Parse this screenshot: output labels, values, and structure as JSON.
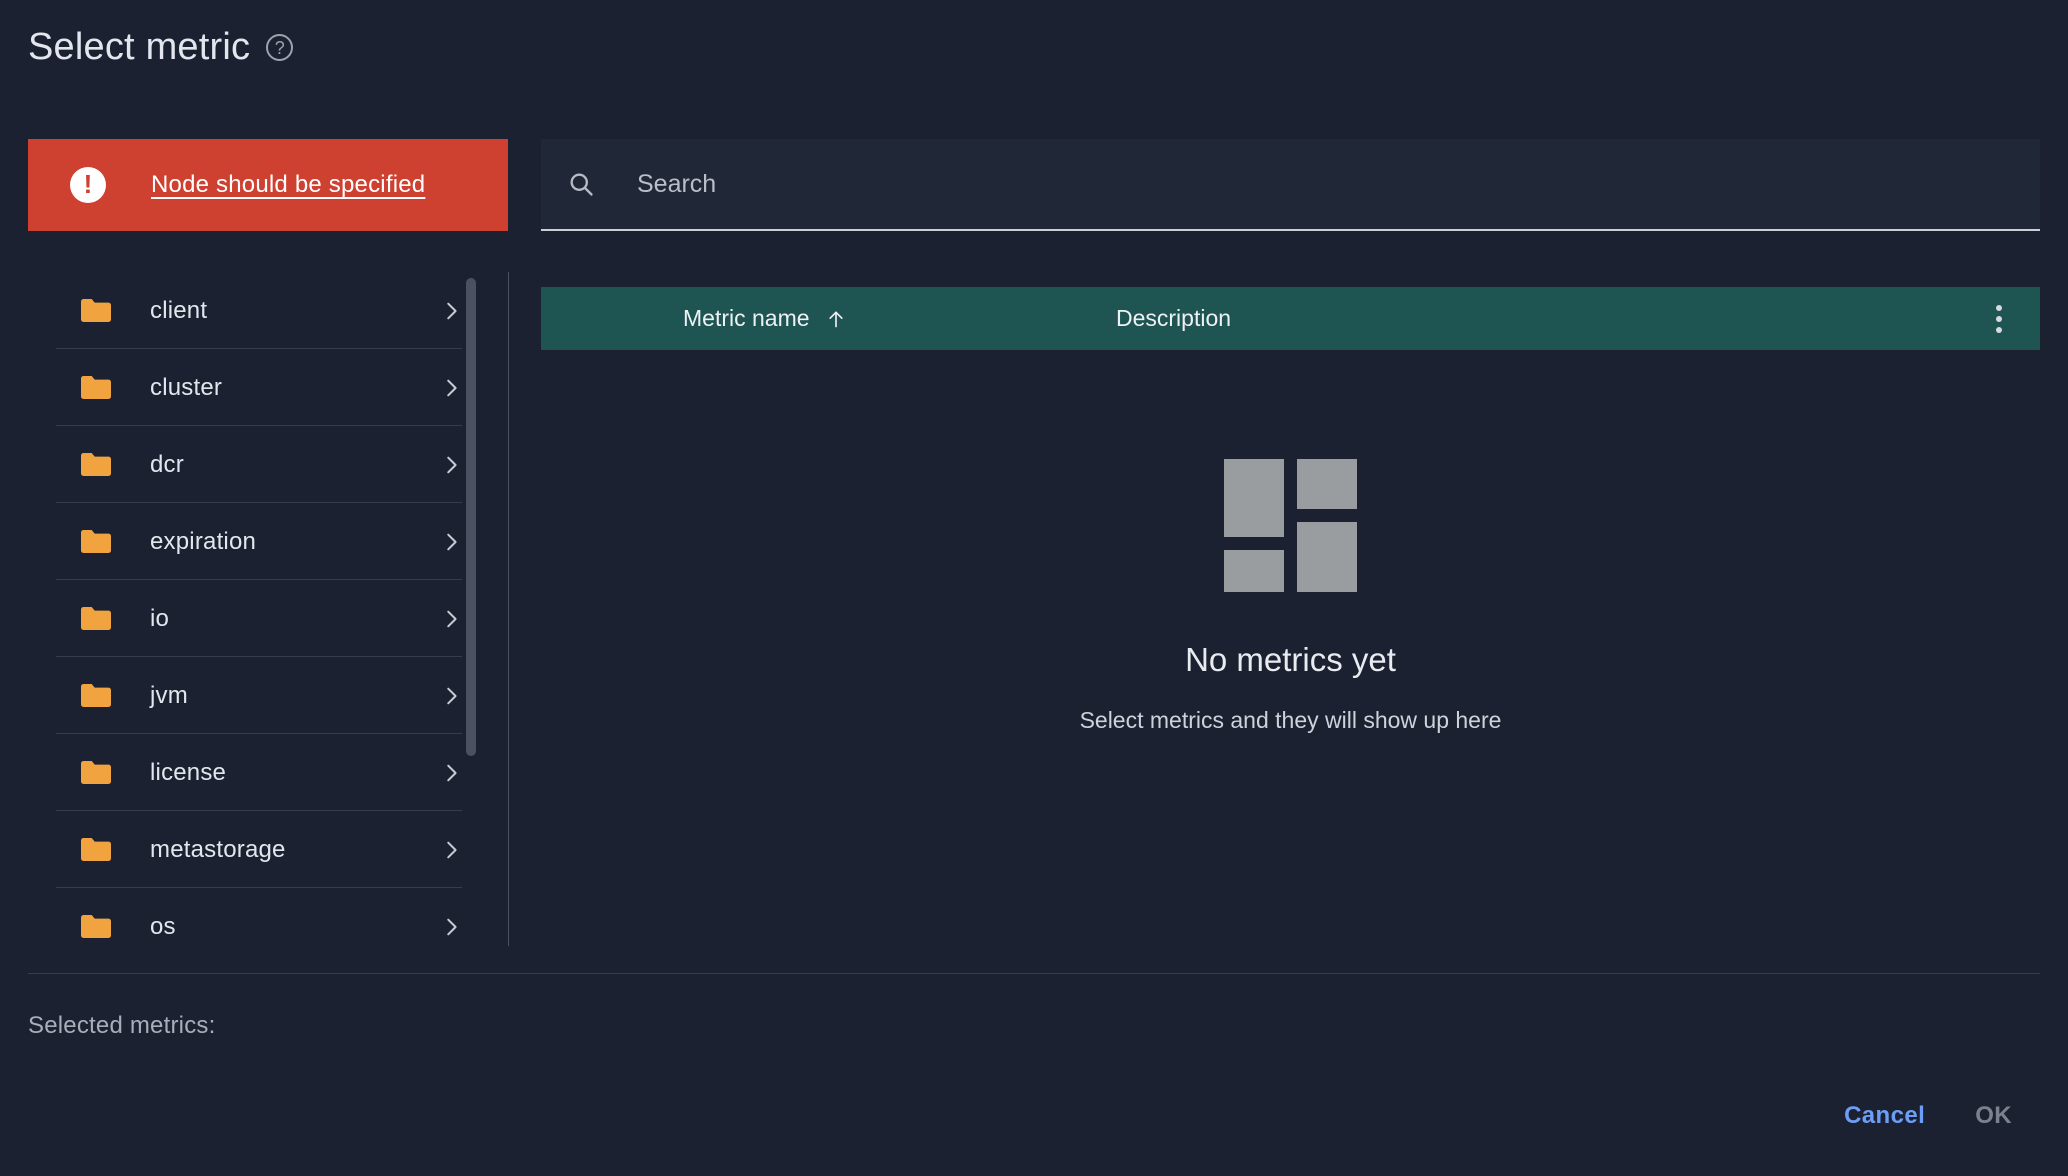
{
  "dialog": {
    "title": "Select metric",
    "help_icon": "help-circle-icon"
  },
  "error_banner": {
    "icon": "error-exclamation-icon",
    "message": "Node should be specified",
    "color": "#ce4030"
  },
  "folder_list": {
    "items": [
      {
        "label": "client",
        "icon": "folder-icon",
        "chevron": "chevron-right-icon"
      },
      {
        "label": "cluster",
        "icon": "folder-icon",
        "chevron": "chevron-right-icon"
      },
      {
        "label": "dcr",
        "icon": "folder-icon",
        "chevron": "chevron-right-icon"
      },
      {
        "label": "expiration",
        "icon": "folder-icon",
        "chevron": "chevron-right-icon"
      },
      {
        "label": "io",
        "icon": "folder-icon",
        "chevron": "chevron-right-icon"
      },
      {
        "label": "jvm",
        "icon": "folder-icon",
        "chevron": "chevron-right-icon"
      },
      {
        "label": "license",
        "icon": "folder-icon",
        "chevron": "chevron-right-icon"
      },
      {
        "label": "metastorage",
        "icon": "folder-icon",
        "chevron": "chevron-right-icon"
      },
      {
        "label": "os",
        "icon": "folder-icon",
        "chevron": "chevron-right-icon"
      }
    ],
    "folder_color": "#f0a33e"
  },
  "search": {
    "icon": "search-icon",
    "placeholder": "Search",
    "value": ""
  },
  "table": {
    "header_color": "#1e5552",
    "columns": [
      {
        "label": "Metric name",
        "sort": "ascending",
        "sort_icon": "arrow-up-icon"
      },
      {
        "label": "Description"
      }
    ],
    "menu_icon": "kebab-menu-icon"
  },
  "empty_state": {
    "icon": "dashboard-grid-icon",
    "title": "No metrics yet",
    "subtitle": "Select metrics and they will show up here"
  },
  "footer": {
    "selected_label": "Selected metrics:",
    "cancel_label": "Cancel",
    "ok_label": "OK",
    "cancel_color": "#6c9ef8",
    "ok_color": "#7c828d"
  }
}
